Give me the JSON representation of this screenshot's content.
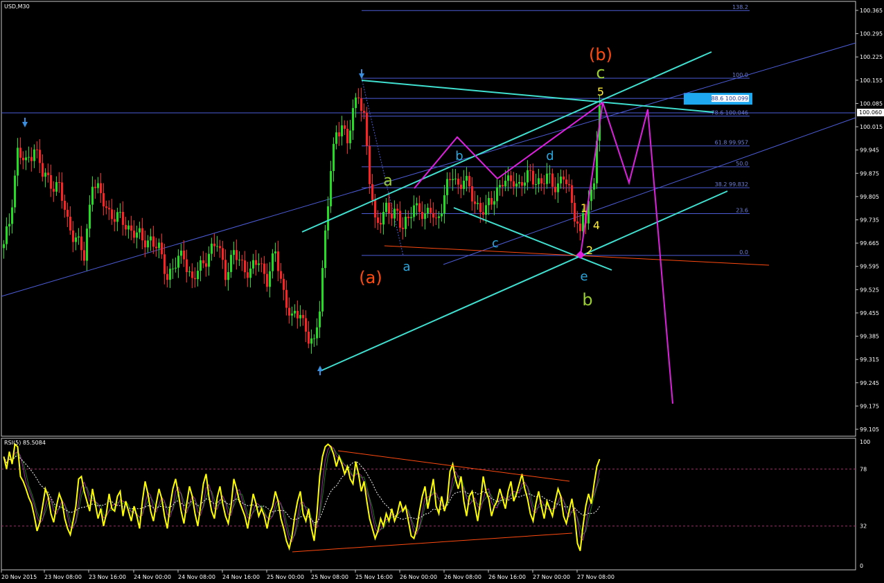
{
  "colors": {
    "background": "#000000",
    "frame": "#c8c8c8",
    "bull": "#22dd22",
    "bear": "#ff2222",
    "wick": "#cccccc",
    "channel": "#40e0d0",
    "trend": "#4d5dd8",
    "fib": "#4d5dd8",
    "path": "#e020e0",
    "orange": "#ff4a10",
    "green": "#9acd32",
    "yellow": "#ffee33",
    "blue": "#29a8e0",
    "rsi": "#ffff00",
    "price_box": "#ffffff",
    "fib_box": "#1ea8f0"
  },
  "chart_title": "USD,M30",
  "current_price": "100.060",
  "rsi_title": "RSI(5) 85.5084",
  "chart_data": {
    "type": "candlestick",
    "symbol": "USD",
    "timeframe": "M30",
    "ylim": [
      99.07,
      100.39
    ],
    "y_ticks": [
      "100.365",
      "100.295",
      "100.225",
      "100.155",
      "100.085",
      "100.015",
      "99.945",
      "99.875",
      "99.805",
      "99.735",
      "99.665",
      "99.595",
      "99.525",
      "99.455",
      "99.385",
      "99.315",
      "99.245",
      "99.175",
      "99.105"
    ],
    "x_ticks": [
      "20 Nov 2015",
      "23 Nov 08:00",
      "23 Nov 16:00",
      "24 Nov 00:00",
      "24 Nov 08:00",
      "24 Nov 16:00",
      "25 Nov 00:00",
      "25 Nov 08:00",
      "25 Nov 16:00",
      "26 Nov 00:00",
      "26 Nov 08:00",
      "26 Nov 16:00",
      "27 Nov 00:00",
      "27 Nov 08:00"
    ],
    "anchors": [
      [
        0,
        99.65
      ],
      [
        2,
        99.73
      ],
      [
        5,
        99.94
      ],
      [
        8,
        99.9
      ],
      [
        11,
        99.96
      ],
      [
        14,
        99.87
      ],
      [
        17,
        99.85
      ],
      [
        20,
        99.83
      ],
      [
        23,
        99.73
      ],
      [
        26,
        99.68
      ],
      [
        29,
        99.62
      ],
      [
        32,
        99.86
      ],
      [
        35,
        99.8
      ],
      [
        38,
        99.76
      ],
      [
        41,
        99.74
      ],
      [
        44,
        99.72
      ],
      [
        47,
        99.7
      ],
      [
        50,
        99.67
      ],
      [
        53,
        99.68
      ],
      [
        56,
        99.64
      ],
      [
        59,
        99.57
      ],
      [
        62,
        99.6
      ],
      [
        65,
        99.63
      ],
      [
        68,
        99.55
      ],
      [
        71,
        99.59
      ],
      [
        74,
        99.64
      ],
      [
        77,
        99.66
      ],
      [
        80,
        99.58
      ],
      [
        83,
        99.63
      ],
      [
        86,
        99.6
      ],
      [
        89,
        99.58
      ],
      [
        92,
        99.61
      ],
      [
        95,
        99.56
      ],
      [
        98,
        99.63
      ],
      [
        101,
        99.52
      ],
      [
        104,
        99.43
      ],
      [
        107,
        99.46
      ],
      [
        110,
        99.38
      ],
      [
        112,
        99.35
      ],
      [
        114,
        99.48
      ],
      [
        116,
        99.7
      ],
      [
        118,
        99.88
      ],
      [
        120,
        99.99
      ],
      [
        122,
        100.03
      ],
      [
        124,
        99.97
      ],
      [
        126,
        100.05
      ],
      [
        128,
        100.12
      ],
      [
        130,
        100.05
      ],
      [
        132,
        99.85
      ],
      [
        134,
        99.72
      ],
      [
        136,
        99.75
      ],
      [
        138,
        99.77
      ],
      [
        140,
        99.74
      ],
      [
        142,
        99.76
      ],
      [
        144,
        99.72
      ],
      [
        146,
        99.73
      ],
      [
        148,
        99.77
      ],
      [
        150,
        99.78
      ],
      [
        152,
        99.74
      ],
      [
        154,
        99.76
      ],
      [
        156,
        99.73
      ],
      [
        158,
        99.78
      ],
      [
        160,
        99.83
      ],
      [
        162,
        99.87
      ],
      [
        164,
        99.84
      ],
      [
        166,
        99.86
      ],
      [
        168,
        99.82
      ],
      [
        170,
        99.79
      ],
      [
        172,
        99.77
      ],
      [
        174,
        99.76
      ],
      [
        176,
        99.79
      ],
      [
        178,
        99.83
      ],
      [
        180,
        99.85
      ],
      [
        182,
        99.84
      ],
      [
        184,
        99.86
      ],
      [
        186,
        99.84
      ],
      [
        188,
        99.85
      ],
      [
        190,
        99.87
      ],
      [
        192,
        99.86
      ],
      [
        194,
        99.84
      ],
      [
        196,
        99.86
      ],
      [
        198,
        99.85
      ],
      [
        200,
        99.84
      ],
      [
        202,
        99.86
      ],
      [
        204,
        99.82
      ],
      [
        206,
        99.76
      ],
      [
        207,
        99.73
      ],
      [
        208,
        99.68
      ],
      [
        209,
        99.75
      ],
      [
        210,
        99.73
      ],
      [
        211,
        99.78
      ],
      [
        212,
        99.82
      ],
      [
        213,
        99.87
      ],
      [
        214,
        99.99
      ],
      [
        215,
        100.06
      ]
    ],
    "fibonacci": {
      "low": 99.628,
      "high": 100.161,
      "levels": [
        {
          "ratio": 0.0,
          "label": "0.0"
        },
        {
          "ratio": 0.236,
          "label": "23.6"
        },
        {
          "ratio": 0.382,
          "label": "38.2 99.832"
        },
        {
          "ratio": 0.5,
          "label": "50.0"
        },
        {
          "ratio": 0.618,
          "label": "61.8 99.957"
        },
        {
          "ratio": 0.786,
          "label": "78.6 100.046"
        },
        {
          "ratio": 0.886,
          "label": "88.6 100.099"
        },
        {
          "ratio": 1.0,
          "label": "100.0"
        },
        {
          "ratio": 1.382,
          "label": "138.2"
        }
      ]
    },
    "wave_labels": [
      "(b)",
      "c",
      "5",
      "a",
      "b",
      "d",
      "c",
      "1",
      "4",
      "2",
      "(a)",
      "a",
      "e",
      "b"
    ],
    "rsi": {
      "period": 5,
      "value": 85.5084,
      "ylim": [
        0,
        100
      ],
      "y_ticks": [
        "100",
        "78",
        "32",
        "0"
      ],
      "levels": [
        78,
        32
      ],
      "anchors": [
        [
          0,
          88
        ],
        [
          1,
          78
        ],
        [
          2,
          92
        ],
        [
          3,
          82
        ],
        [
          4,
          98
        ],
        [
          5,
          96
        ],
        [
          6,
          72
        ],
        [
          7,
          68
        ],
        [
          8,
          62
        ],
        [
          9,
          55
        ],
        [
          10,
          50
        ],
        [
          11,
          40
        ],
        [
          12,
          28
        ],
        [
          13,
          35
        ],
        [
          14,
          48
        ],
        [
          15,
          62
        ],
        [
          16,
          56
        ],
        [
          17,
          42
        ],
        [
          18,
          35
        ],
        [
          19,
          48
        ],
        [
          20,
          58
        ],
        [
          21,
          52
        ],
        [
          22,
          38
        ],
        [
          23,
          30
        ],
        [
          24,
          25
        ],
        [
          25,
          36
        ],
        [
          26,
          48
        ],
        [
          27,
          70
        ],
        [
          28,
          72
        ],
        [
          29,
          60
        ],
        [
          30,
          52
        ],
        [
          31,
          44
        ],
        [
          32,
          62
        ],
        [
          33,
          50
        ],
        [
          34,
          38
        ],
        [
          35,
          46
        ],
        [
          36,
          32
        ],
        [
          37,
          42
        ],
        [
          38,
          58
        ],
        [
          39,
          46
        ],
        [
          40,
          44
        ],
        [
          41,
          56
        ],
        [
          42,
          60
        ],
        [
          43,
          40
        ],
        [
          44,
          52
        ],
        [
          45,
          44
        ],
        [
          46,
          36
        ],
        [
          47,
          48
        ],
        [
          48,
          40
        ],
        [
          49,
          30
        ],
        [
          50,
          52
        ],
        [
          51,
          68
        ],
        [
          52,
          58
        ],
        [
          53,
          44
        ],
        [
          54,
          36
        ],
        [
          55,
          50
        ],
        [
          56,
          62
        ],
        [
          57,
          54
        ],
        [
          58,
          40
        ],
        [
          59,
          30
        ],
        [
          60,
          48
        ],
        [
          61,
          62
        ],
        [
          62,
          70
        ],
        [
          63,
          58
        ],
        [
          64,
          44
        ],
        [
          65,
          34
        ],
        [
          66,
          50
        ],
        [
          67,
          64
        ],
        [
          68,
          56
        ],
        [
          69,
          42
        ],
        [
          70,
          32
        ],
        [
          71,
          48
        ],
        [
          72,
          66
        ],
        [
          73,
          74
        ],
        [
          74,
          56
        ],
        [
          75,
          44
        ],
        [
          76,
          38
        ],
        [
          77,
          55
        ],
        [
          78,
          64
        ],
        [
          79,
          50
        ],
        [
          80,
          40
        ],
        [
          81,
          34
        ],
        [
          82,
          48
        ],
        [
          83,
          70
        ],
        [
          84,
          62
        ],
        [
          85,
          52
        ],
        [
          86,
          46
        ],
        [
          87,
          40
        ],
        [
          88,
          30
        ],
        [
          89,
          44
        ],
        [
          90,
          58
        ],
        [
          91,
          50
        ],
        [
          92,
          40
        ],
        [
          93,
          46
        ],
        [
          94,
          40
        ],
        [
          95,
          30
        ],
        [
          96,
          42
        ],
        [
          97,
          48
        ],
        [
          98,
          60
        ],
        [
          99,
          52
        ],
        [
          100,
          38
        ],
        [
          101,
          30
        ],
        [
          102,
          20
        ],
        [
          103,
          14
        ],
        [
          104,
          24
        ],
        [
          105,
          40
        ],
        [
          106,
          52
        ],
        [
          107,
          60
        ],
        [
          108,
          42
        ],
        [
          109,
          36
        ],
        [
          110,
          46
        ],
        [
          111,
          30
        ],
        [
          112,
          20
        ],
        [
          113,
          42
        ],
        [
          114,
          72
        ],
        [
          115,
          88
        ],
        [
          116,
          96
        ],
        [
          117,
          98
        ],
        [
          118,
          96
        ],
        [
          119,
          90
        ],
        [
          120,
          80
        ],
        [
          121,
          88
        ],
        [
          122,
          82
        ],
        [
          123,
          74
        ],
        [
          124,
          80
        ],
        [
          125,
          70
        ],
        [
          126,
          66
        ],
        [
          127,
          84
        ],
        [
          128,
          74
        ],
        [
          129,
          60
        ],
        [
          130,
          68
        ],
        [
          131,
          52
        ],
        [
          132,
          38
        ],
        [
          133,
          30
        ],
        [
          134,
          22
        ],
        [
          135,
          28
        ],
        [
          136,
          38
        ],
        [
          137,
          32
        ],
        [
          138,
          42
        ],
        [
          139,
          36
        ],
        [
          140,
          46
        ],
        [
          141,
          36
        ],
        [
          142,
          42
        ],
        [
          143,
          52
        ],
        [
          144,
          44
        ],
        [
          145,
          48
        ],
        [
          146,
          36
        ],
        [
          147,
          24
        ],
        [
          148,
          22
        ],
        [
          149,
          30
        ],
        [
          150,
          44
        ],
        [
          151,
          56
        ],
        [
          152,
          64
        ],
        [
          153,
          46
        ],
        [
          154,
          58
        ],
        [
          155,
          70
        ],
        [
          156,
          48
        ],
        [
          157,
          42
        ],
        [
          158,
          56
        ],
        [
          159,
          44
        ],
        [
          160,
          52
        ],
        [
          161,
          76
        ],
        [
          162,
          82
        ],
        [
          163,
          70
        ],
        [
          164,
          62
        ],
        [
          165,
          72
        ],
        [
          166,
          52
        ],
        [
          167,
          40
        ],
        [
          168,
          56
        ],
        [
          169,
          60
        ],
        [
          170,
          48
        ],
        [
          171,
          36
        ],
        [
          172,
          52
        ],
        [
          173,
          72
        ],
        [
          174,
          60
        ],
        [
          175,
          54
        ],
        [
          176,
          40
        ],
        [
          177,
          48
        ],
        [
          178,
          52
        ],
        [
          179,
          62
        ],
        [
          180,
          54
        ],
        [
          181,
          46
        ],
        [
          182,
          60
        ],
        [
          183,
          68
        ],
        [
          184,
          52
        ],
        [
          185,
          58
        ],
        [
          186,
          66
        ],
        [
          187,
          74
        ],
        [
          188,
          62
        ],
        [
          189,
          54
        ],
        [
          190,
          42
        ],
        [
          191,
          36
        ],
        [
          192,
          50
        ],
        [
          193,
          60
        ],
        [
          194,
          48
        ],
        [
          195,
          38
        ],
        [
          196,
          52
        ],
        [
          197,
          46
        ],
        [
          198,
          40
        ],
        [
          199,
          52
        ],
        [
          200,
          62
        ],
        [
          201,
          56
        ],
        [
          202,
          40
        ],
        [
          203,
          34
        ],
        [
          204,
          44
        ],
        [
          205,
          54
        ],
        [
          206,
          40
        ],
        [
          207,
          18
        ],
        [
          208,
          12
        ],
        [
          209,
          32
        ],
        [
          210,
          48
        ],
        [
          211,
          58
        ],
        [
          212,
          50
        ],
        [
          213,
          66
        ],
        [
          214,
          80
        ],
        [
          215,
          86
        ]
      ]
    }
  }
}
